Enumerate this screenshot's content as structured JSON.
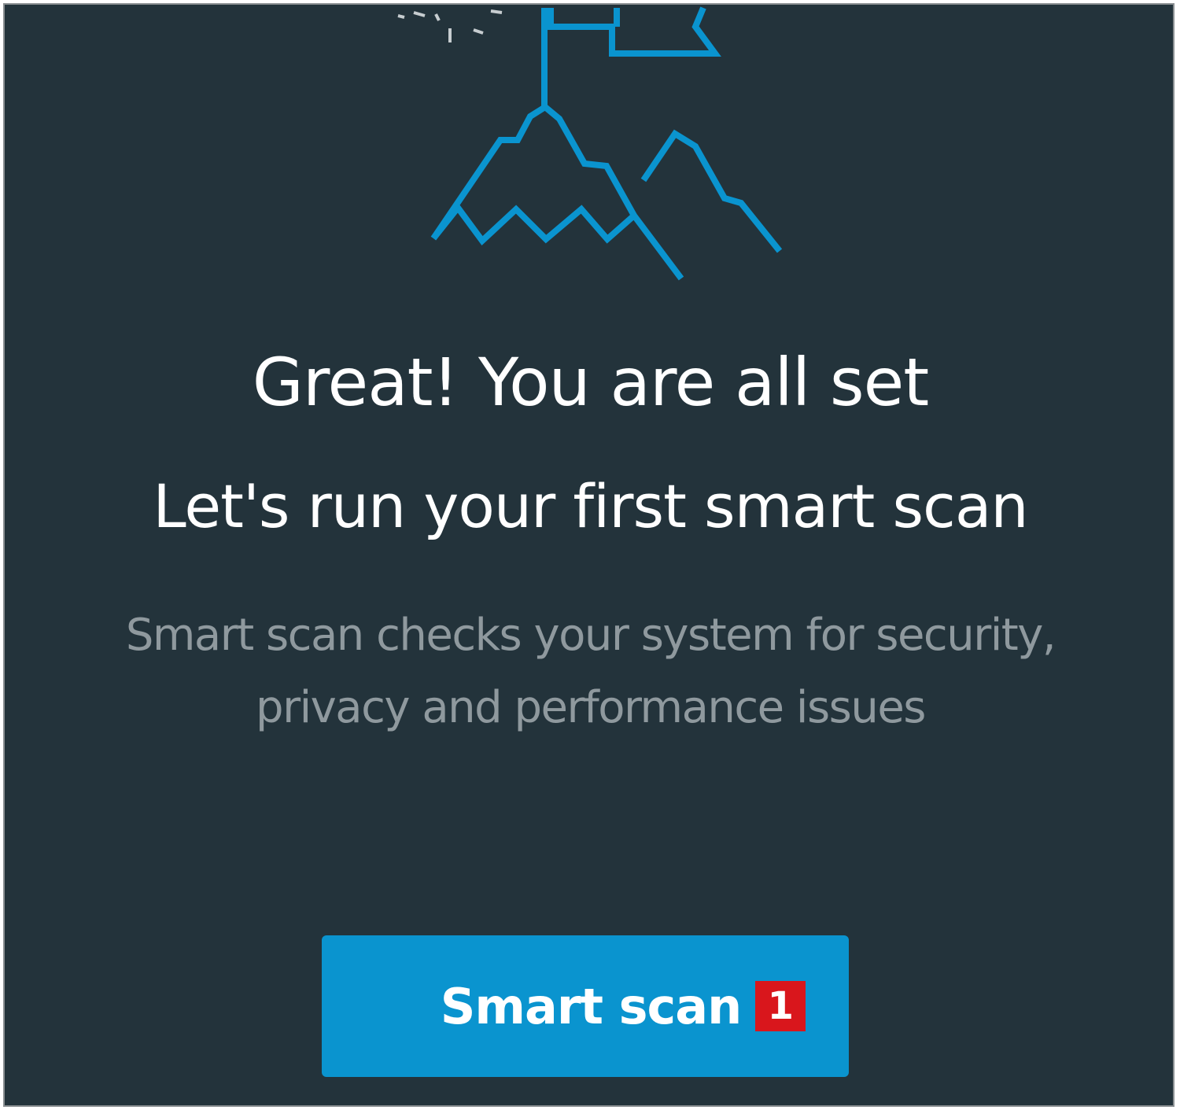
{
  "panel": {
    "illustration": "mountain-flag-icon",
    "title": "Great! You are all set",
    "subtitle": "Let's run your first smart scan",
    "description": "Smart scan checks your system for security, privacy and performance issues"
  },
  "button": {
    "label": "Smart scan",
    "badge": "1"
  },
  "colors": {
    "background": "#23333b",
    "accent": "#0a94cf",
    "badge": "#d9161c",
    "muted_text": "#8f999e"
  }
}
